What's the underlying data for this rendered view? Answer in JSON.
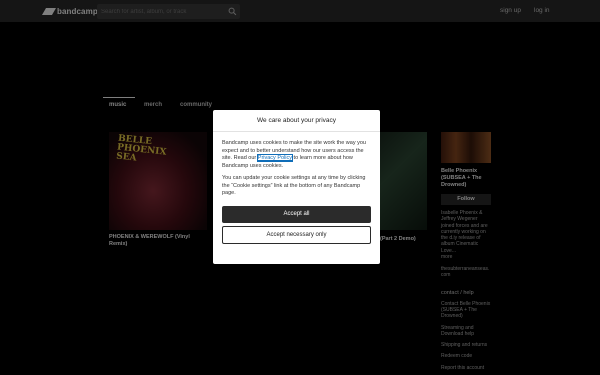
{
  "topbar": {
    "logo_text": "bandcamp",
    "search_placeholder": "Search for artist, album, or track",
    "signup": "sign up",
    "login": "log in"
  },
  "tabs": [
    "music",
    "merch",
    "community"
  ],
  "albums": [
    {
      "title": "PHOENIX & WEREWOLF (Vinyl Remix)",
      "art_text": "BELLE PHOENIX SEA"
    },
    {
      "title": "(Part 2 Demo)"
    }
  ],
  "artist": {
    "name": "Belle Phoenix (SUBSEA + The Drowned)",
    "follow_label": "Follow",
    "bio": "Isabelle Phoenix & Jeffrey Wegener joined forces and are currently working on the d.iy release of album Cinematic Love...",
    "more": "more",
    "website": "thesubterraneanseas.com",
    "section_title": "contact / help",
    "links": [
      "Contact Belle Phoenix (SUBSEA + The Drowned)",
      "Streaming and Download help",
      "Shipping and returns",
      "Redeem code",
      "Report this account"
    ]
  },
  "modal": {
    "title": "We care about your privacy",
    "p1_before": "Bandcamp uses cookies to make the site work the way you expect and to better understand how our users access the site. Read our ",
    "p1_link": "Privacy Policy",
    "p1_after": " to learn more about how Bandcamp uses cookies.",
    "p2": "You can update your cookie settings at any time by clicking the “Cookie settings” link at the bottom of any Bandcamp page.",
    "accept_all": "Accept all",
    "accept_necessary": "Accept necessary only"
  },
  "colors": {
    "page_bg": "#000000",
    "topbar_bg": "#2b2b2b",
    "button_dark": "#2b2b2b",
    "link": "#0f6db8"
  }
}
